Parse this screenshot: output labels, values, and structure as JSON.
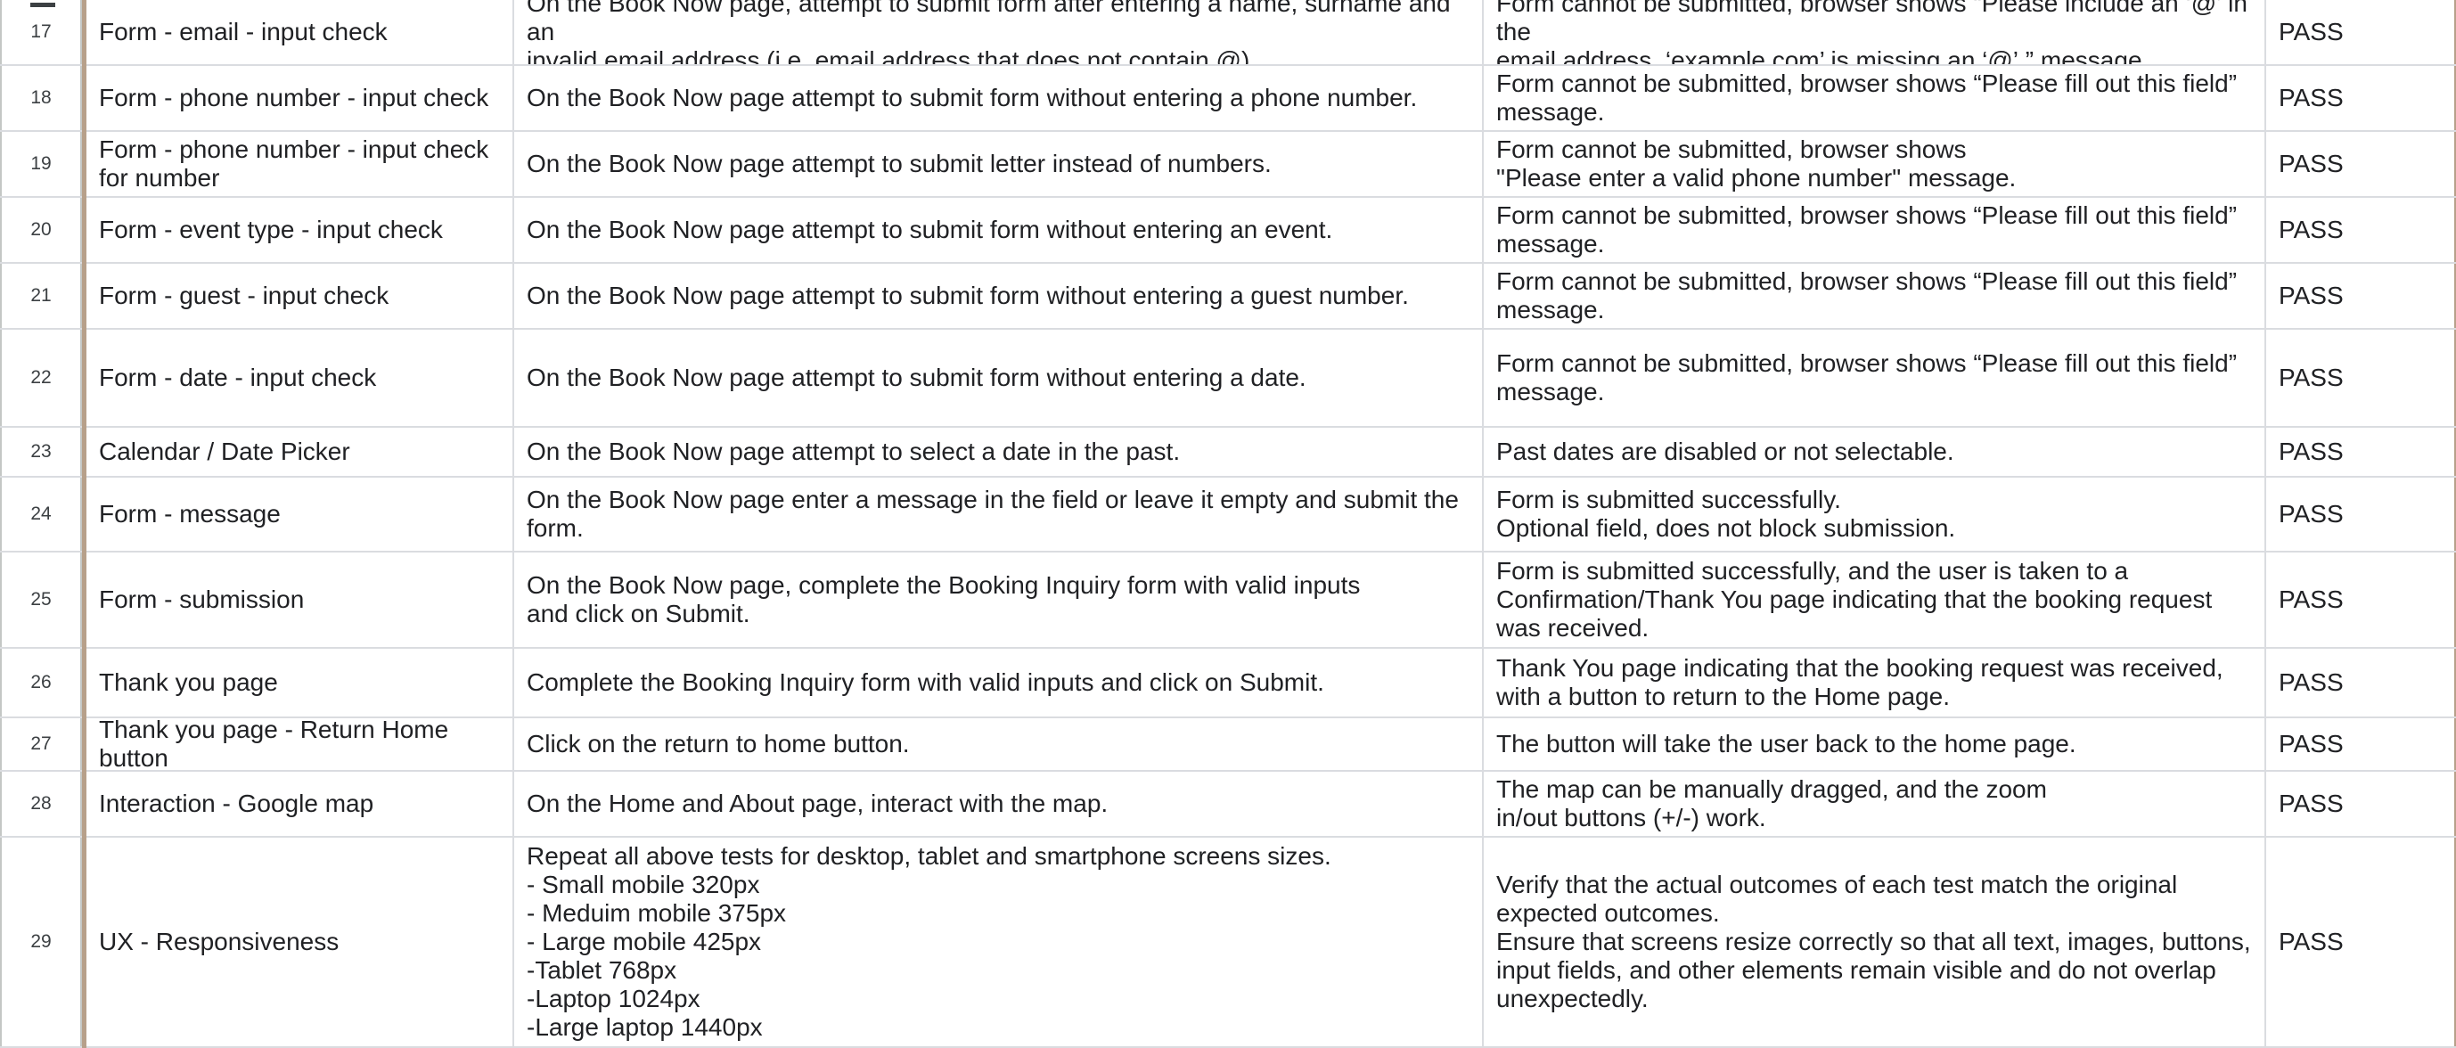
{
  "rows": [
    {
      "num": "17",
      "feature": "Form - email - input check",
      "test": "On the Book Now page, attempt to submit form after entering a name, surname and an\ninvalid email address (i.e. email address that does not contain @).",
      "expected": "Form cannot be submitted, browser shows “Please include an ‘@’ in the\nemail address. ‘example.com’ is missing an ‘@’.” message.",
      "result": "PASS"
    },
    {
      "num": "18",
      "feature": "Form - phone number - input check",
      "test": "On the Book Now page attempt to submit form without entering a phone number.",
      "expected": "Form cannot be submitted, browser shows “Please fill out this field”\nmessage.",
      "result": "PASS"
    },
    {
      "num": "19",
      "feature": "Form - phone number - input check\nfor number",
      "test": "On the Book Now page attempt to submit letter instead of numbers.",
      "expected": "Form cannot be submitted, browser shows\n\"Please enter a valid phone number\" message.",
      "result": "PASS"
    },
    {
      "num": "20",
      "feature": "Form - event type - input check",
      "test": "On the Book Now page attempt to submit form without entering an event.",
      "expected": "Form cannot be submitted, browser shows “Please fill out this field”\nmessage.",
      "result": "PASS"
    },
    {
      "num": "21",
      "feature": "Form - guest - input check",
      "test": "On the Book Now page attempt to submit form without entering a guest number.",
      "expected": "Form cannot be submitted, browser shows “Please fill out this field”\nmessage.",
      "result": "PASS"
    },
    {
      "num": "22",
      "feature": "Form - date - input check",
      "test": "On the Book Now page attempt to submit form without entering a date.",
      "expected": "Form cannot be submitted, browser shows “Please fill out this field”\nmessage.",
      "result": "PASS"
    },
    {
      "num": "23",
      "feature": "Calendar / Date Picker",
      "test": "On the Book Now page attempt to select a date in the past.",
      "expected": "Past dates are disabled or not selectable.",
      "result": "PASS"
    },
    {
      "num": "24",
      "feature": "Form - message",
      "test": "On the Book Now page enter a message in the field or leave it empty and submit the form.",
      "expected": "Form is submitted successfully.\nOptional field, does not block submission.",
      "result": "PASS"
    },
    {
      "num": "25",
      "feature": "Form - submission",
      "test": "On the Book Now page, complete the Booking Inquiry form with valid inputs\nand click on Submit.",
      "expected": "Form is submitted successfully, and the user is taken to a\nConfirmation/Thank You page indicating that the booking request\nwas received.",
      "result": "PASS"
    },
    {
      "num": "26",
      "feature": "Thank you page",
      "test": "Complete the Booking Inquiry form with valid inputs and click on Submit.",
      "expected": "Thank You page indicating that the booking request was received,\nwith a button to return to the Home page.",
      "result": "PASS"
    },
    {
      "num": "27",
      "feature": "Thank you page - Return Home button",
      "test": "Click on the return to home button.",
      "expected": "The button will take the user back to the home page.",
      "result": "PASS"
    },
    {
      "num": "28",
      "feature": "Interaction - Google map",
      "test": "On the Home and About  page, interact with the map.",
      "expected": "The map can be manually dragged, and the zoom\nin/out buttons (+/-) work.",
      "result": "PASS"
    },
    {
      "num": "29",
      "feature": "UX - Responsiveness",
      "test": "Repeat all above tests for desktop, tablet and smartphone screens sizes.\n- Small mobile 320px\n- Meduim mobile 375px\n- Large mobile 425px\n-Tablet 768px\n-Laptop 1024px\n-Large laptop 1440px",
      "expected": "Verify that the actual outcomes of each test match the original\nexpected outcomes.\nEnsure that screens resize correctly so that all text, images, buttons,\ninput fields, and other elements remain visible and do not overlap\nunexpectedly.",
      "result": "PASS"
    }
  ]
}
